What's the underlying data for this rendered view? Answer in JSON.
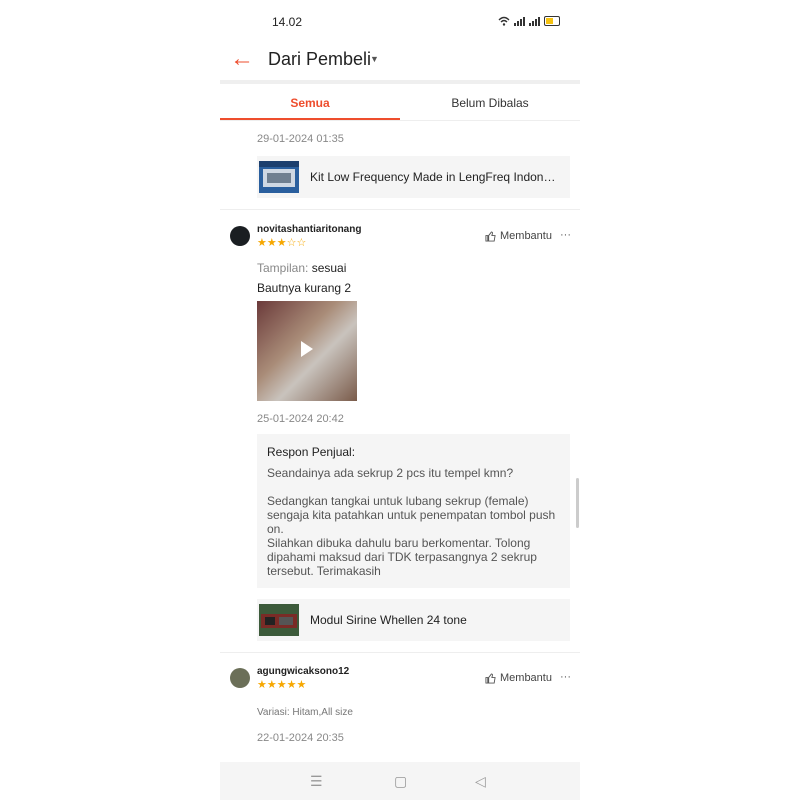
{
  "status": {
    "time": "14.02",
    "icons": [
      "wifi-icon",
      "signal-icon",
      "signal-icon",
      "battery-icon"
    ]
  },
  "header": {
    "title": "Dari Pembeli",
    "back_icon": "back-arrow-icon",
    "dropdown_icon": "caret-down-icon"
  },
  "tabs": [
    {
      "label": "Semua",
      "active": true
    },
    {
      "label": "Belum Dibalas",
      "active": false
    }
  ],
  "reviews": [
    {
      "date": "29-01-2024 01:35",
      "product": "Kit Low Frequency Made in LengFreq Indone..."
    },
    {
      "username": "novitashantiaritonang",
      "rating": 3,
      "helpful_label": "Membantu",
      "more": "···",
      "lines": [
        {
          "label": "Tampilan:",
          "value": " sesuai"
        },
        {
          "value": "Bautnya kurang 2"
        }
      ],
      "date": "25-01-2024 20:42",
      "response": {
        "heading": "Respon Penjual:",
        "paragraphs": [
          "Seandainya ada sekrup 2 pcs itu tempel kmn?",
          "Sedangkan tangkai untuk lubang sekrup (female) sengaja kita patahkan untuk penempatan tombol push on.",
          "Silahkan dibuka dahulu baru berkomentar. Tolong dipahami maksud dari TDK terpasangnya 2 sekrup tersebut. Terimakasih"
        ]
      },
      "product": "Modul Sirine Whellen 24 tone"
    },
    {
      "username": "agungwicaksono12",
      "rating": 5,
      "helpful_label": "Membantu",
      "more": "···",
      "variation": "Variasi: Hitam,All size",
      "date": "22-01-2024 20:35"
    }
  ],
  "navbar": {
    "items": [
      "menu-icon",
      "home-icon",
      "back-icon"
    ]
  },
  "colors": {
    "accent": "#ee4d2d",
    "star": "#f6a700"
  }
}
